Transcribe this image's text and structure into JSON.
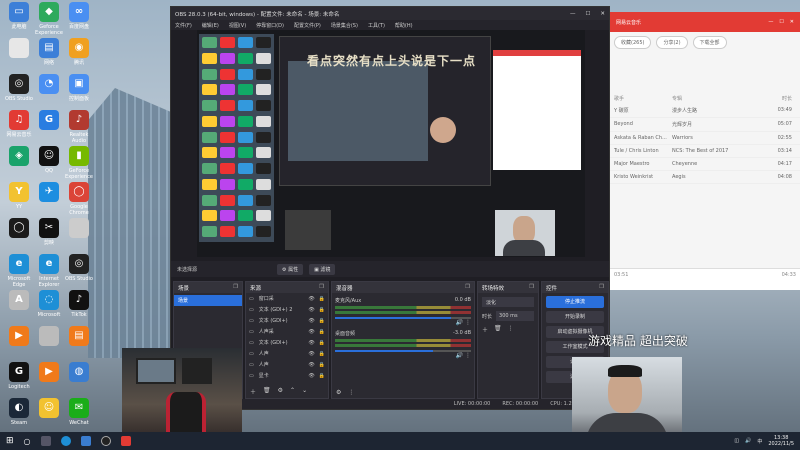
{
  "desktop": {
    "icons": [
      {
        "label": "此电脑",
        "color": "#3c7fd8",
        "glyph": "▭"
      },
      {
        "label": "Geforce Experience",
        "color": "#2eaa5c",
        "glyph": "◆"
      },
      {
        "label": "百度网盘",
        "color": "#4a8ff2",
        "glyph": "∞"
      },
      {
        "label": "",
        "color": "#e7e7e7",
        "glyph": ""
      },
      {
        "label": "网络",
        "color": "#3c7fd8",
        "glyph": "▤"
      },
      {
        "label": "腾讯",
        "color": "#f0a020",
        "glyph": "◉"
      },
      {
        "label": "OBS Studio",
        "color": "#222",
        "glyph": "◎"
      },
      {
        "label": "",
        "color": "#4a8ff2",
        "glyph": "◔"
      },
      {
        "label": "控制面板",
        "color": "#4a8ff2",
        "glyph": "▣"
      },
      {
        "label": "网易云音乐",
        "color": "#e23b34",
        "glyph": "♫"
      },
      {
        "label": "",
        "color": "#2a7de1",
        "glyph": "G"
      },
      {
        "label": "Realtek Audio",
        "color": "#b23a30",
        "glyph": "♪"
      },
      {
        "label": "",
        "color": "#1aa36b",
        "glyph": "◈"
      },
      {
        "label": "QQ",
        "color": "#111",
        "glyph": "☺"
      },
      {
        "label": "GeForce Experience",
        "color": "#76b900",
        "glyph": "▮"
      },
      {
        "label": "YY",
        "color": "#f2c230",
        "glyph": "Y"
      },
      {
        "label": "",
        "color": "#1d8ee0",
        "glyph": "✈"
      },
      {
        "label": "Google Chrome",
        "color": "#db4437",
        "glyph": "◯"
      },
      {
        "label": "",
        "color": "#1b1b1b",
        "glyph": "◯"
      },
      {
        "label": "剪映",
        "color": "#111",
        "glyph": "✂"
      },
      {
        "label": "",
        "color": "#ccc",
        "glyph": ""
      },
      {
        "label": "Microsoft Edge",
        "color": "#1e8fd6",
        "glyph": "e"
      },
      {
        "label": "Internet Explorer",
        "color": "#1e8fd6",
        "glyph": "e"
      },
      {
        "label": "OBS Studio",
        "color": "#222",
        "glyph": "◎"
      },
      {
        "label": "",
        "color": "#bbb",
        "glyph": "A"
      },
      {
        "label": "Microsoft",
        "color": "#1e8fd6",
        "glyph": "◌"
      },
      {
        "label": "TikTok",
        "color": "#111",
        "glyph": "♪"
      },
      {
        "label": "",
        "color": "#f07a1a",
        "glyph": "▶"
      },
      {
        "label": "",
        "color": "#bbb",
        "glyph": ""
      },
      {
        "label": "",
        "color": "#f07a1a",
        "glyph": "▤"
      },
      {
        "label": "Logitech",
        "color": "#111",
        "glyph": "G"
      },
      {
        "label": "",
        "color": "#f07a1a",
        "glyph": "▶"
      },
      {
        "label": "",
        "color": "#3a7dd0",
        "glyph": "◍"
      },
      {
        "label": "Steam",
        "color": "#1b2838",
        "glyph": "◐"
      },
      {
        "label": "",
        "color": "#f2c230",
        "glyph": "☺"
      },
      {
        "label": "WeChat",
        "color": "#1aad19",
        "glyph": "✉"
      }
    ]
  },
  "obs": {
    "title": "OBS 28.0.3 (64-bit, windows) - 配置文件: 未命名 - 场景: 未命名",
    "menu": [
      "文件(F)",
      "编辑(E)",
      "视图(V)",
      "停靠窗口(D)",
      "配置文件(P)",
      "场景集合(S)",
      "工具(T)",
      "帮助(H)"
    ],
    "win_buttons": [
      "—",
      "☐",
      "✕"
    ],
    "preview_overlay": "看点突然有点上头说是下一点",
    "scene_bar": {
      "label": "未选择源",
      "props_btn": "⚙ 属性",
      "filter_btn": "▣ 滤镜"
    },
    "scenes": {
      "title": "场景",
      "items": [
        "场景"
      ]
    },
    "sources": {
      "title": "来源",
      "items": [
        "窗口采",
        "文本 (GDI+) 2",
        "文本 (GDI+)",
        "人声采",
        "文本 (GDI+)",
        "人声",
        "人声",
        "显卡"
      ]
    },
    "mixer": {
      "title": "混音器",
      "tracks": [
        {
          "name": "麦克风/Aux",
          "db": "0.0 dB",
          "level": 0.85
        },
        {
          "name": "桌面音频",
          "db": "-3.0 dB",
          "level": 0.72
        }
      ]
    },
    "transitions": {
      "title": "转场特效",
      "type": "淡化",
      "duration_label": "时长",
      "duration": "300 ms"
    },
    "controls": {
      "title": "控件",
      "buttons": [
        "停止推流",
        "开始录制",
        "启动虚拟摄像机",
        "工作室模式",
        "设置",
        "退出"
      ]
    },
    "status": {
      "live": "LIVE: 00:00:00",
      "rec": "REC: 00:00:00",
      "cpu": "CPU: 1.2%, 60.00 fps"
    }
  },
  "music": {
    "title": "网易云音乐",
    "buttons": [
      "收藏(265)",
      "分享(2)",
      "下载全部"
    ],
    "columns": [
      "歌手",
      "专辑",
      "时长"
    ],
    "rows": [
      {
        "artist": "Y 碳原",
        "album": "漫步人生路",
        "time": "03:49"
      },
      {
        "artist": "Beyond",
        "album": "光辉岁月",
        "time": "05:07"
      },
      {
        "artist": "Askata & Raban Ch...",
        "album": "Warriors",
        "time": "02:55"
      },
      {
        "artist": "Tule / Chris Linton",
        "album": "NCS: The Best of 2017",
        "time": "03:14"
      },
      {
        "artist": "Major Maestro",
        "album": "Cheyenne",
        "time": "04:17"
      },
      {
        "artist": "Kristo Weinkrist",
        "album": "Aegis",
        "time": "04:08"
      }
    ],
    "player_time": "03:51",
    "player_total": "04:33"
  },
  "stream_caption": "游戏精品 超出突破",
  "taskbar": {
    "time": "13:38",
    "date": "2022/11/5",
    "lang": "中"
  }
}
